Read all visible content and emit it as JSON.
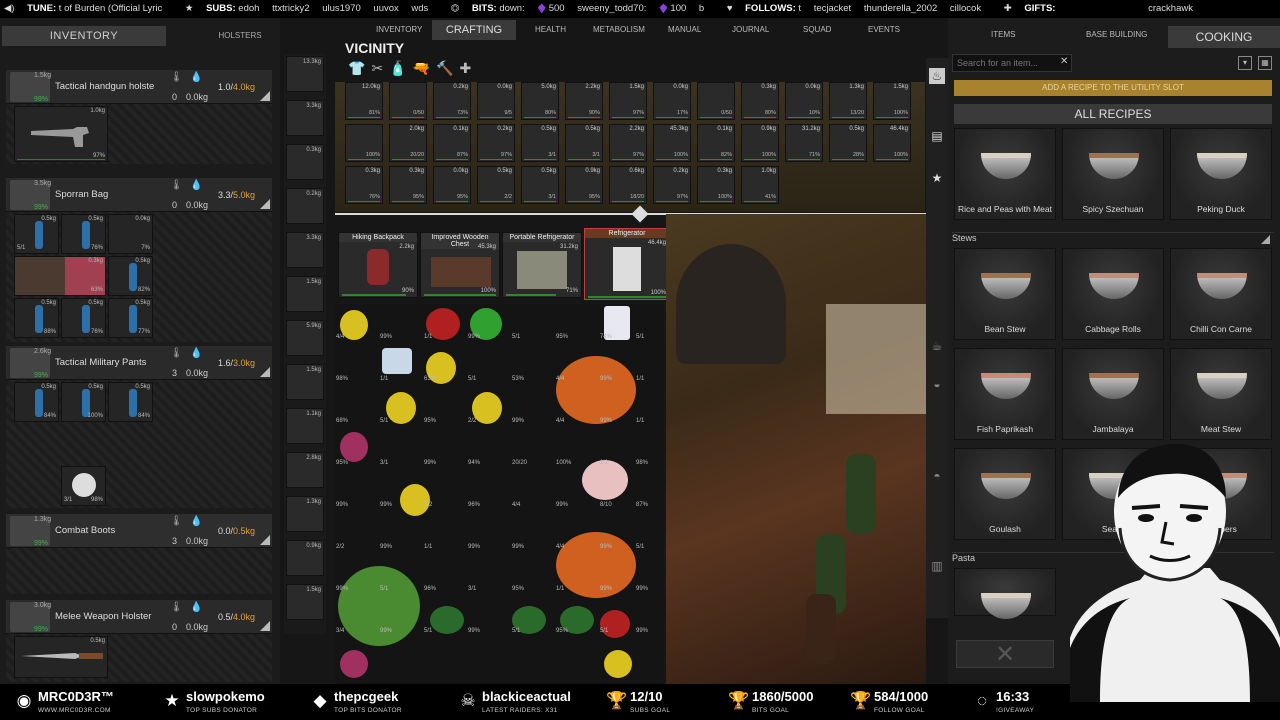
{
  "ticker": {
    "tune_label": "TUNE:",
    "tune_value": "t of Burden (Official Lyric",
    "subs_label": "SUBS:",
    "subs_values": [
      "edoh",
      "ttxtricky2",
      "ulus1970",
      "uuvox",
      "wds"
    ],
    "bits_label": "BITS:",
    "bits_entries": [
      {
        "name": "down:",
        "amount": "500"
      },
      {
        "name": "sweeny_todd70:",
        "amount": "100"
      }
    ],
    "bits_trailing": "b",
    "follows_label": "FOLLOWS:",
    "follows_values": [
      "t",
      "tecjacket",
      "thunderella_2002",
      "cillocok"
    ],
    "gifts_label": "GIFTS:",
    "gifts_value": "crackhawk"
  },
  "left_panel": {
    "inventory_tab": "INVENTORY",
    "holsters_tab": "HOLSTERS",
    "slots": [
      {
        "name": "Tactical handgun holste",
        "weight_icon_val": "0",
        "water_val": "0.0kg",
        "weight": "1.0/",
        "max": "4.0kg",
        "icon_weight": "1.5kg",
        "icon_pct": "99%"
      },
      {
        "name": "Sporran Bag",
        "weight_icon_val": "0",
        "water_val": "0.0kg",
        "weight": "3.3/",
        "max": "5.0kg",
        "icon_weight": "3.5kg",
        "icon_pct": "99%"
      },
      {
        "name": "Tactical Military Pants",
        "weight_icon_val": "3",
        "water_val": "0.0kg",
        "weight": "1.6/",
        "max": "3.0kg",
        "icon_weight": "2.6kg",
        "icon_pct": "99%"
      },
      {
        "name": "Combat Boots",
        "weight_icon_val": "3",
        "water_val": "0.0kg",
        "weight": "0.0/",
        "max": "0.5kg",
        "icon_weight": "1.3kg",
        "icon_pct": "99%"
      },
      {
        "name": "Melee Weapon Holster",
        "weight_icon_val": "0",
        "water_val": "0.0kg",
        "weight": "0.5/",
        "max": "4.0kg",
        "icon_weight": "3.0kg",
        "icon_pct": "99%"
      }
    ],
    "revolver": {
      "weight": "1.0kg",
      "pct": "97%"
    },
    "sporran_items": [
      {
        "w": "0.5kg",
        "d": "5/1"
      },
      {
        "w": "0.5kg",
        "d": "76%"
      },
      {
        "w": "0.0kg",
        "d": "7%"
      },
      {
        "w": "0.3kg",
        "d": "63%"
      },
      {
        "w": "0.5kg",
        "d": "82%"
      },
      {
        "w": "0.5kg",
        "d": "88%"
      },
      {
        "w": "0.5kg",
        "d": "76%"
      },
      {
        "w": "0.5kg",
        "d": "77%"
      }
    ],
    "pants_items": [
      {
        "w": "0.5kg",
        "d": "84%"
      },
      {
        "w": "0.5kg",
        "d": "100%"
      },
      {
        "w": "0.5kg",
        "d": "84%"
      }
    ],
    "garlic": {
      "d": "3/1",
      "p": "98%"
    },
    "knife": {
      "w": "0.5kg"
    }
  },
  "strip": {
    "weights": [
      "13.3kg",
      "3.3kg",
      "0.3kg",
      "0.2kg",
      "3.3kg",
      "1.5kg",
      "5.9kg",
      "1.5kg",
      "1.1kg",
      "2.8kg",
      "1.3kg",
      "0.9kg",
      "1.5kg"
    ]
  },
  "top_nav": {
    "tabs": [
      "INVENTORY",
      "CRAFTING",
      "HEALTH",
      "METABOLISM",
      "MANUAL",
      "JOURNAL",
      "SQUAD",
      "EVENTS"
    ],
    "active": "CRAFTING"
  },
  "vicinity": {
    "title": "VICINITY",
    "tools": [
      "shirt",
      "scissors",
      "bottle",
      "gun",
      "hammer",
      "plus"
    ],
    "rows": [
      [
        {
          "w": "12.0kg",
          "p": "81%"
        },
        {
          "w": "",
          "p": "0/50"
        },
        {
          "w": "0.2kg",
          "p": "73%"
        },
        {
          "w": "0.0kg",
          "p": "9/5"
        },
        {
          "w": "5.0kg",
          "p": "80%"
        },
        {
          "w": "2.2kg",
          "p": "90%"
        },
        {
          "w": "1.5kg",
          "p": "97%"
        },
        {
          "w": "0.0kg",
          "p": "17%"
        },
        {
          "w": "",
          "p": "0/50"
        },
        {
          "w": "0.3kg",
          "p": "80%"
        },
        {
          "w": "0.0kg",
          "p": "10%"
        },
        {
          "w": "1.3kg",
          "p": "13/20"
        },
        {
          "w": "1.5kg",
          "p": "100%"
        }
      ],
      [
        {
          "w": "",
          "p": "100%"
        },
        {
          "w": "2.0kg",
          "p": "20/20"
        },
        {
          "w": "0.1kg",
          "p": "87%"
        },
        {
          "w": "0.2kg",
          "p": "97%"
        },
        {
          "w": "0.5kg",
          "p": "3/1"
        },
        {
          "w": "0.5kg",
          "p": "3/1"
        },
        {
          "w": "2.2kg",
          "p": "97%"
        },
        {
          "w": "45.3kg",
          "p": "100%"
        },
        {
          "w": "0.1kg",
          "p": "82%"
        },
        {
          "w": "0.9kg",
          "p": "100%"
        },
        {
          "w": "31.2kg",
          "p": "71%"
        },
        {
          "w": "0.5kg",
          "p": "28%"
        },
        {
          "w": "46.4kg",
          "p": "100%"
        }
      ],
      [
        {
          "w": "0.3kg",
          "p": "76%"
        },
        {
          "w": "0.3kg",
          "p": "95%"
        },
        {
          "w": "0.0kg",
          "p": "95%"
        },
        {
          "w": "0.5kg",
          "p": "2/2"
        },
        {
          "w": "0.5kg",
          "p": "3/1"
        },
        {
          "w": "0.9kg",
          "p": "95%"
        },
        {
          "w": "0.6kg",
          "p": "18/20"
        },
        {
          "w": "0.2kg",
          "p": "97%"
        },
        {
          "w": "0.3kg",
          "p": "100%"
        },
        {
          "w": "1.0kg",
          "p": "41%"
        }
      ]
    ]
  },
  "containers": [
    {
      "name": "Hiking Backpack",
      "weight": "2.2kg",
      "pct": "90%"
    },
    {
      "name": "Improved Wooden Chest",
      "weight": "45.3kg",
      "pct": "100%"
    },
    {
      "name": "Portable Refrigerator",
      "weight": "31.2kg",
      "pct": "71%"
    },
    {
      "name": "Refrigerator",
      "weight": "46.4kg",
      "pct": "100%"
    }
  ],
  "fridge_labels": [
    "4/4",
    "99%",
    "1/1",
    "99%",
    "5/1",
    "95%",
    "74%",
    "5/1",
    "98%",
    "1/1",
    "63%",
    "5/1",
    "53%",
    "4/4",
    "99%",
    "1/1",
    "68%",
    "5/1",
    "95%",
    "2/2",
    "99%",
    "4/4",
    "99%",
    "1/1",
    "95%",
    "3/1",
    "99%",
    "94%",
    "20/20",
    "100%",
    "1/1",
    "98%",
    "99%",
    "99%",
    "2/2",
    "96%",
    "4/4",
    "99%",
    "8/10",
    "87%",
    "2/2",
    "99%",
    "1/1",
    "99%",
    "99%",
    "4/4",
    "99%",
    "5/1",
    "99%",
    "5/1",
    "96%",
    "3/1",
    "95%",
    "1/1",
    "99%",
    "99%",
    "3/4",
    "99%",
    "5/1",
    "99%",
    "5/1",
    "95%",
    "5/1",
    "99%"
  ],
  "right_panel": {
    "tabs": [
      "ITEMS",
      "BASE BUILDING",
      "COOKING"
    ],
    "active_tab": "COOKING",
    "search_placeholder": "Search for an item...",
    "add_recipe_text": "ADD A RECIPE TO THE UTILITY SLOT",
    "all_recipes": "ALL RECIPES",
    "recipes_top": [
      "Rice and Peas with Meat",
      "Spicy Szechuan",
      "Peking Duck"
    ],
    "sections": [
      "Stews",
      "Pasta"
    ],
    "stews": [
      "Bean Stew",
      "Cabbage Rolls",
      "Chilli Con Carne",
      "Fish Paprikash",
      "Jambalaya",
      "Meat Stew",
      "Goulash",
      "Seafo",
      "Peppers"
    ]
  },
  "bottom_bar": [
    {
      "icon": "cat-icon",
      "main": "MRC0D3R™",
      "sub": "WWW.MRC0D3R.COM"
    },
    {
      "icon": "star-icon",
      "main": "slowpokemo",
      "sub": "TOP SUBS DONATOR"
    },
    {
      "icon": "gem-icon",
      "main": "thepcgeek",
      "sub": "TOP BITS DONATOR"
    },
    {
      "icon": "raider-icon",
      "main": "blackiceactual",
      "sub": "LATEST RAIDERS: X31"
    },
    {
      "icon": "trophy-icon",
      "main": "12/10",
      "sub": "SUBS GOAL"
    },
    {
      "icon": "trophy-icon",
      "main": "1860/5000",
      "sub": "BITS GOAL"
    },
    {
      "icon": "trophy-icon",
      "main": "584/1000",
      "sub": "FOLLOW GOAL"
    },
    {
      "icon": "timer-icon",
      "main": "16:33",
      "sub": "!GIVEAWAY"
    }
  ]
}
